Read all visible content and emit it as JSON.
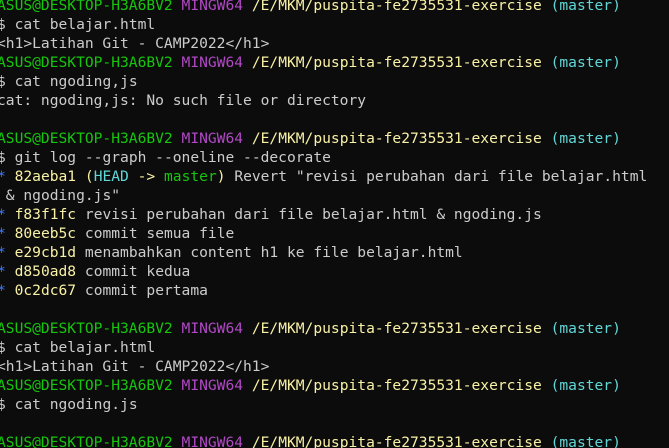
{
  "terminal": {
    "prompt": {
      "user_host": "ASUS@DESKTOP-H3A6BV2",
      "env": "MINGW64",
      "path": "/E/MKM/puspita-fe2735531-exercise",
      "branch": "(master)",
      "symbol": "$"
    },
    "commands": {
      "cat_belajar": "cat belajar.html",
      "cat_ngoding_comma": "cat ngoding,js",
      "git_log": "git log --graph --oneline --decorate",
      "cat_belajar_2": "cat belajar.html",
      "cat_ngoding_js": "cat ngoding.js"
    },
    "outputs": {
      "html_content": "<h1>Latihan Git - CAMP2022</h1>",
      "cat_error": "cat: ngoding,js: No such file or directory",
      "html_content_2": "<h1>Latihan Git - CAMP2022</h1>"
    },
    "git_log": {
      "graph_marker": "*",
      "head_ref": {
        "open": "(",
        "head": "HEAD",
        "arrow": " -> ",
        "branch": "master",
        "close": ")"
      },
      "commits": [
        {
          "hash": "82aeba1",
          "message_line1": "Revert \"revisi perubahan dari file belajar.html",
          "message_line2": "& ngoding.js\""
        },
        {
          "hash": "f83f1fc",
          "message": "revisi perubahan dari file belajar.html & ngoding.js"
        },
        {
          "hash": "80eeb5c",
          "message": "commit semua file"
        },
        {
          "hash": "e29cb1d",
          "message": "menambahkan content h1 ke file belajar.html"
        },
        {
          "hash": "d850ad8",
          "message": "commit kedua"
        },
        {
          "hash": "0c2dc67",
          "message": "commit pertama"
        }
      ]
    },
    "colors": {
      "background": "#0c0c0c",
      "user_host": "#16c60c",
      "env": "#b148c6",
      "path": "#f9f1a5",
      "branch": "#61d6d6",
      "hash": "#f9f1a5",
      "head": "#61d6d6",
      "master_ref": "#16c60c",
      "graph": "#3b78ff",
      "text": "#cccccc"
    }
  }
}
